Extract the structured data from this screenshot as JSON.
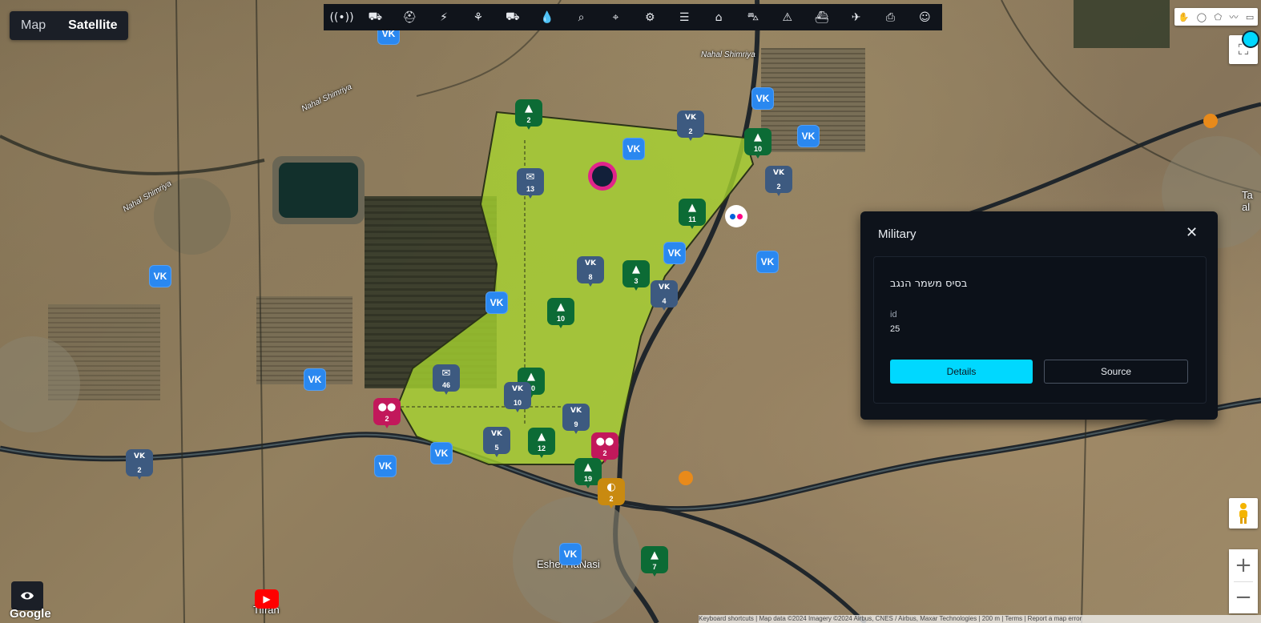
{
  "map_type": {
    "map_label": "Map",
    "satellite_label": "Satellite",
    "selected": "Satellite"
  },
  "toolbar": {
    "items": [
      {
        "name": "antenna",
        "glyph": "((•))"
      },
      {
        "name": "ambulance",
        "glyph": "⛟"
      },
      {
        "name": "hiker",
        "glyph": "⛑"
      },
      {
        "name": "lightning",
        "glyph": "⚡"
      },
      {
        "name": "network",
        "glyph": "⚘"
      },
      {
        "name": "truck",
        "glyph": "⛟"
      },
      {
        "name": "water-drop",
        "glyph": "💧"
      },
      {
        "name": "search-location",
        "glyph": "⌕"
      },
      {
        "name": "map-pin",
        "glyph": "⌖"
      },
      {
        "name": "gear",
        "glyph": "⚙"
      },
      {
        "name": "newspaper",
        "glyph": "☰"
      },
      {
        "name": "home",
        "glyph": "⌂"
      },
      {
        "name": "car",
        "glyph": "⛍"
      },
      {
        "name": "warning",
        "glyph": "⚠"
      },
      {
        "name": "ship",
        "glyph": "⛴"
      },
      {
        "name": "airplane",
        "glyph": "✈"
      },
      {
        "name": "bus",
        "glyph": "⎙"
      },
      {
        "name": "robot",
        "glyph": "☺"
      }
    ]
  },
  "place_labels": {
    "nahal_shimriya": "Nahal Shimriya",
    "nahal_shimriya_2": "Nahal Shimriya",
    "nahal_shimriya_3": "Nahal Shimriya",
    "eshel_hanasi": "Eshel HaNasi",
    "tifrah": "Tifrah",
    "ta_al": "Ta\nal"
  },
  "markers": [
    {
      "type": "military",
      "count": "2",
      "color": "#0c6b35"
    },
    {
      "type": "vk",
      "count": "2",
      "color": "#3d5a80"
    },
    {
      "type": "military",
      "count": "10",
      "color": "#0c6b35"
    },
    {
      "type": "vk",
      "count": "2",
      "color": "#3d5a80"
    },
    {
      "type": "twitter",
      "count": "13",
      "color": "#3d5a80"
    },
    {
      "type": "military",
      "count": "11",
      "color": "#0c6b35"
    },
    {
      "type": "vk",
      "count": "8",
      "color": "#3d5a80"
    },
    {
      "type": "military",
      "count": "3",
      "color": "#0c6b35"
    },
    {
      "type": "vk",
      "count": "4",
      "color": "#3d5a80"
    },
    {
      "type": "military",
      "count": "10",
      "color": "#0c6b35"
    },
    {
      "type": "twitter",
      "count": "46",
      "color": "#3d5a80"
    },
    {
      "type": "military",
      "count": "30",
      "color": "#0c6b35"
    },
    {
      "type": "vk",
      "count": "10",
      "color": "#3d5a80"
    },
    {
      "type": "flickr",
      "count": "2",
      "color": "#c2185b"
    },
    {
      "type": "vk",
      "count": "9",
      "color": "#3d5a80"
    },
    {
      "type": "vk",
      "count": "5",
      "color": "#3d5a80"
    },
    {
      "type": "military",
      "count": "12",
      "color": "#0c6b35"
    },
    {
      "type": "flickr",
      "count": "2",
      "color": "#c2185b"
    },
    {
      "type": "military",
      "count": "19",
      "color": "#0c6b35"
    },
    {
      "type": "other",
      "count": "2",
      "color": "#c98a10"
    },
    {
      "type": "vk",
      "count": "2",
      "color": "#3d5a80"
    },
    {
      "type": "military",
      "count": "7",
      "color": "#0c6b35"
    }
  ],
  "vk_single_label": "VK",
  "polygon_color": "#a8d630",
  "panel": {
    "title": "Military",
    "close": "✕",
    "name": "בסיס משמר הנגב",
    "id_label": "id",
    "id_value": "25",
    "details_label": "Details",
    "source_label": "Source",
    "accent": "#00d8ff"
  },
  "controls": {
    "zoom_in": "+",
    "zoom_out": "−",
    "google_logo": "Google",
    "attribution": "Keyboard shortcuts | Map data ©2024 Imagery ©2024 Airbus, CNES / Airbus, Maxar Technologies | 200 m | Terms | Report a map error"
  }
}
